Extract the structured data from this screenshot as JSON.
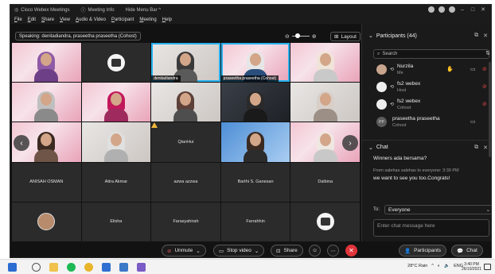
{
  "window": {
    "app_title": "Cisco Webex Meetings",
    "meeting_info": "Meeting Info",
    "hide_menu_bar": "Hide Menu Bar ^",
    "menu": [
      "File",
      "Edit",
      "Share",
      "View",
      "Audio & Video",
      "Participant",
      "Meeting",
      "Help"
    ]
  },
  "speaking": "Speaking: denitadiandra, praseetha praseetha (Cohost)",
  "layout_label": "Layout",
  "tiles": [
    {
      "name": "",
      "kind": "cam"
    },
    {
      "name": "",
      "kind": "logo"
    },
    {
      "name": "denitadiandra",
      "kind": "cam-active"
    },
    {
      "name": "praseetha praseetha (Cohost)",
      "kind": "cam-active"
    },
    {
      "name": "",
      "kind": "cam"
    },
    {
      "name": "",
      "kind": "cam"
    },
    {
      "name": "",
      "kind": "cam"
    },
    {
      "name": "",
      "kind": "cam"
    },
    {
      "name": "",
      "kind": "cam"
    },
    {
      "name": "",
      "kind": "cam"
    },
    {
      "name": "",
      "kind": "cam"
    },
    {
      "name": "",
      "kind": "cam"
    },
    {
      "name": "QianHui",
      "kind": "text"
    },
    {
      "name": "",
      "kind": "cam"
    },
    {
      "name": "",
      "kind": "cam"
    },
    {
      "name": "ANISAH OSMAN",
      "kind": "text"
    },
    {
      "name": "Atira Akmar",
      "kind": "text"
    },
    {
      "name": "azwa azzwa",
      "kind": "text"
    },
    {
      "name": "Barthi S. Ganesan",
      "kind": "text"
    },
    {
      "name": "Dalbina",
      "kind": "text"
    },
    {
      "name": "",
      "kind": "photo"
    },
    {
      "name": "Elisha",
      "kind": "text"
    },
    {
      "name": "Farasyahirah",
      "kind": "text"
    },
    {
      "name": "Farrahhin",
      "kind": "text"
    },
    {
      "name": "",
      "kind": "logo"
    }
  ],
  "participants": {
    "title": "Participants (44)",
    "search_placeholder": "Search",
    "list": [
      {
        "name": "Nurzila",
        "role": "Me"
      },
      {
        "name": "fs2 webex",
        "role": "Host"
      },
      {
        "name": "fs2 webex",
        "role": "Cohost"
      },
      {
        "name": "praseetha praseetha",
        "role": "Cohost",
        "initials": "PP"
      }
    ]
  },
  "chat": {
    "title": "Chat",
    "messages": [
      {
        "text": "Winners ada bersama?"
      },
      {
        "meta": "From salehas salehas to everyone:   3:39 PM",
        "text": "we want to see you too.Congrats!"
      }
    ],
    "to_label": "To:",
    "to_value": "Everyone",
    "input_placeholder": "Enter chat message here"
  },
  "toolbar": {
    "unmute": "Unmute",
    "stop_video": "Stop video",
    "share": "Share",
    "participants": "Participants",
    "chat": "Chat"
  },
  "taskbar": {
    "weather": "28°C  Rain",
    "lang": "ENG",
    "time": "3:40 PM",
    "date": "26/10/2021"
  },
  "colors": {
    "active_border": "#27b0ef",
    "end_button": "#e0343b",
    "muted_icon": "#e0454b"
  }
}
